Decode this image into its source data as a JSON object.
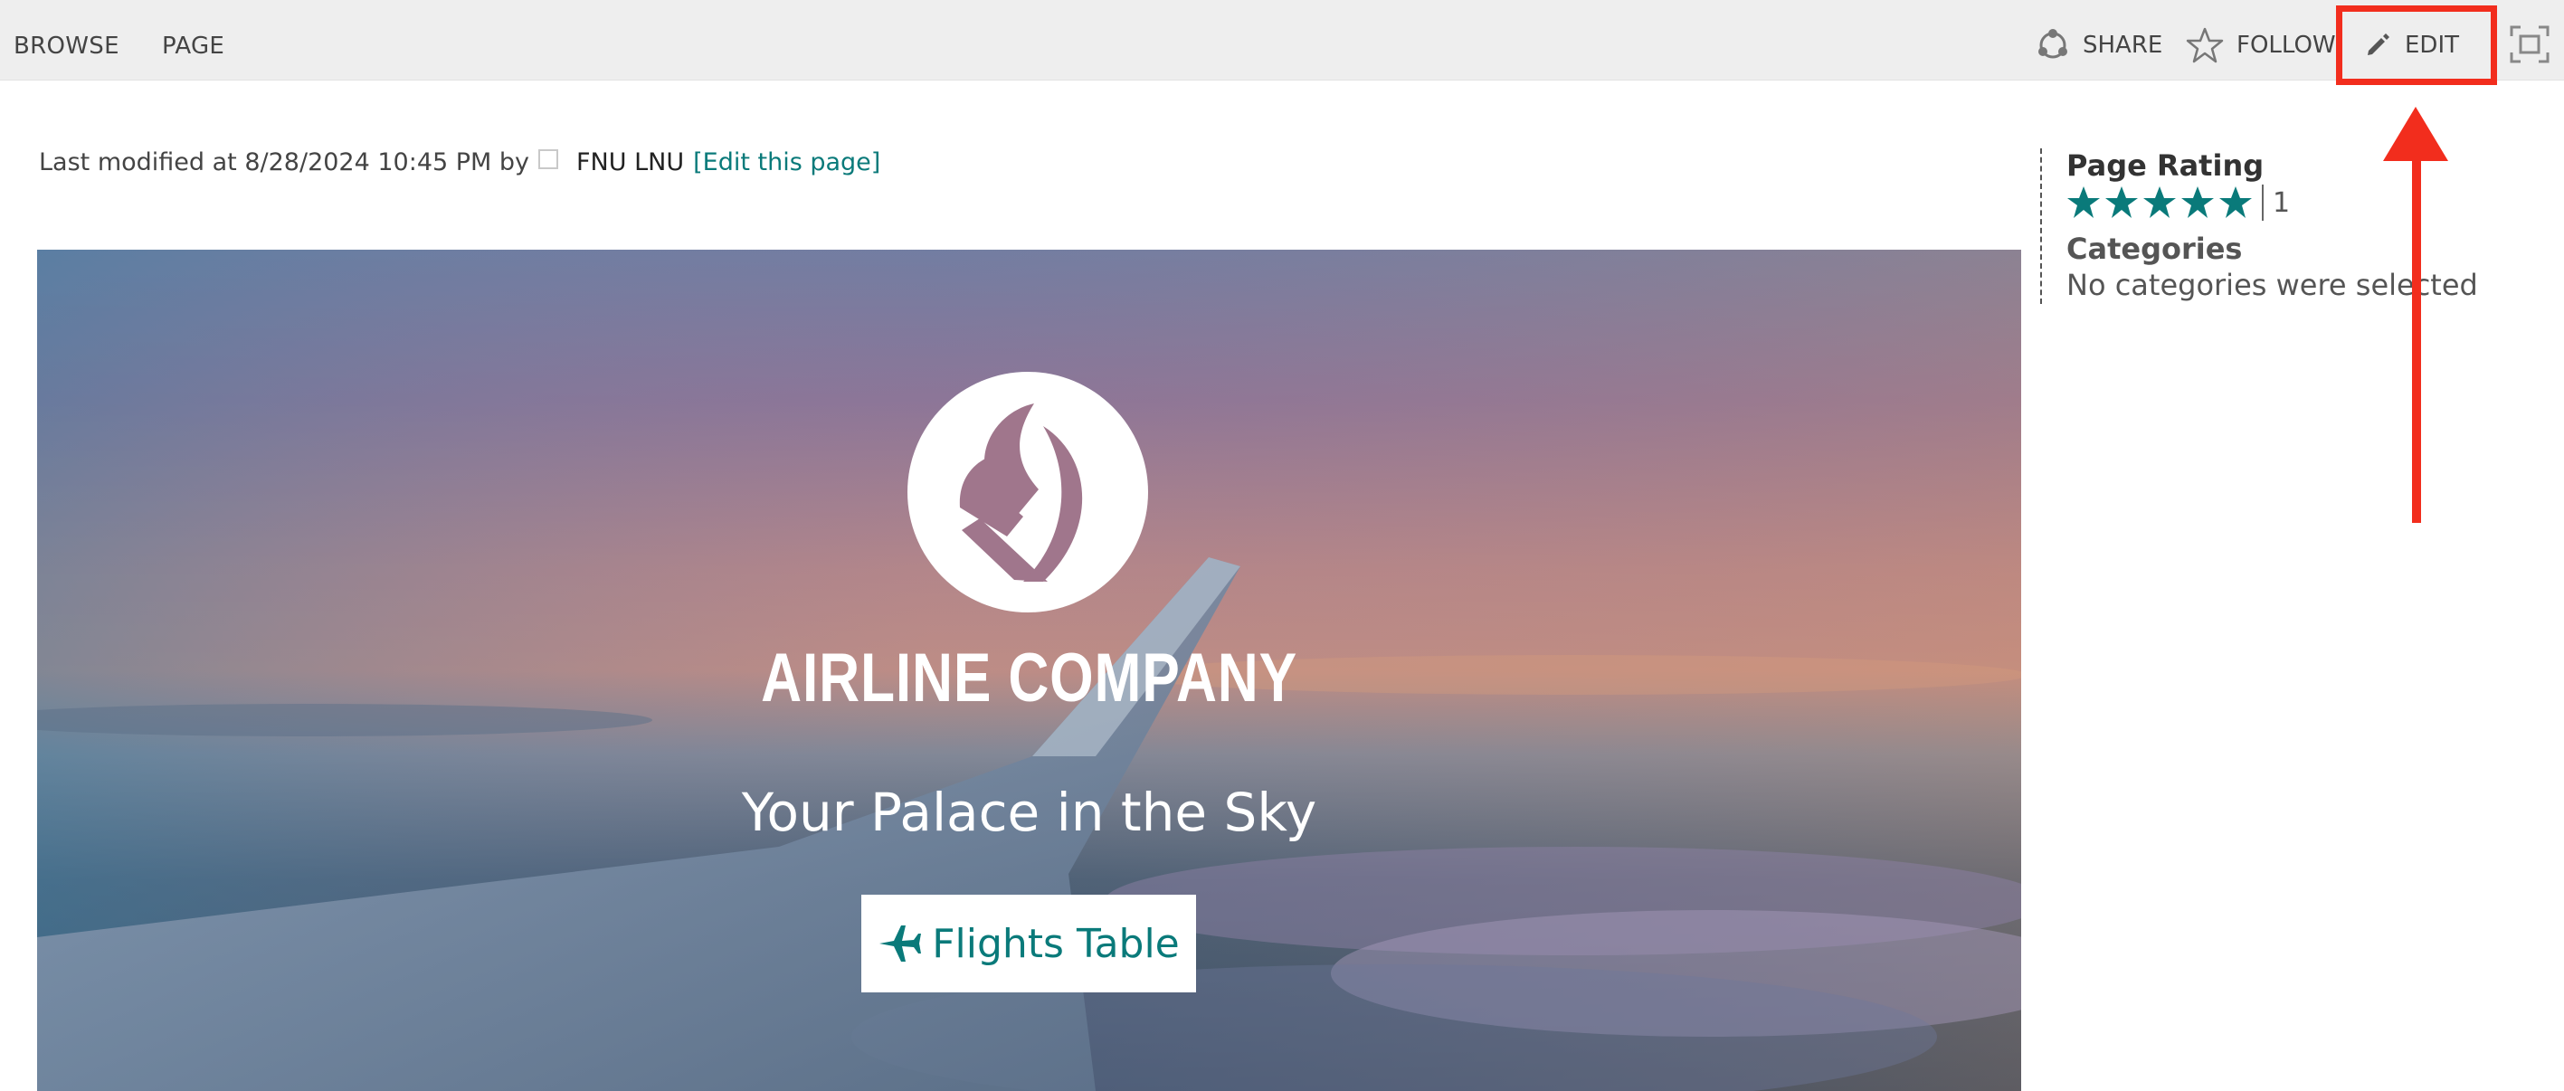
{
  "ribbon": {
    "tabs": [
      "BROWSE",
      "PAGE"
    ],
    "share_label": "SHARE",
    "follow_label": "FOLLOW",
    "edit_label": "EDIT"
  },
  "meta": {
    "prefix": "Last modified at 8/28/2024 10:45 PM by",
    "user": "FNU LNU",
    "edit_link": "[Edit this page]"
  },
  "hero": {
    "company": "AIRLINE COMPANY",
    "tagline": "Your Palace in the Sky",
    "button_label": "Flights Table"
  },
  "rail": {
    "rating_title": "Page Rating",
    "rating_stars": 5,
    "rating_count": "1",
    "categories_title": "Categories",
    "categories_value": "No categories were selected"
  },
  "colors": {
    "accent": "#0a7a7a",
    "annotation": "#f22d1d",
    "ribbon_bg": "#eeeeee"
  },
  "icons": [
    "share-icon",
    "star-outline-icon",
    "pencil-icon",
    "focus-mode-icon",
    "user-presence-icon",
    "airplane-icon",
    "star-icon",
    "airline-logo"
  ]
}
